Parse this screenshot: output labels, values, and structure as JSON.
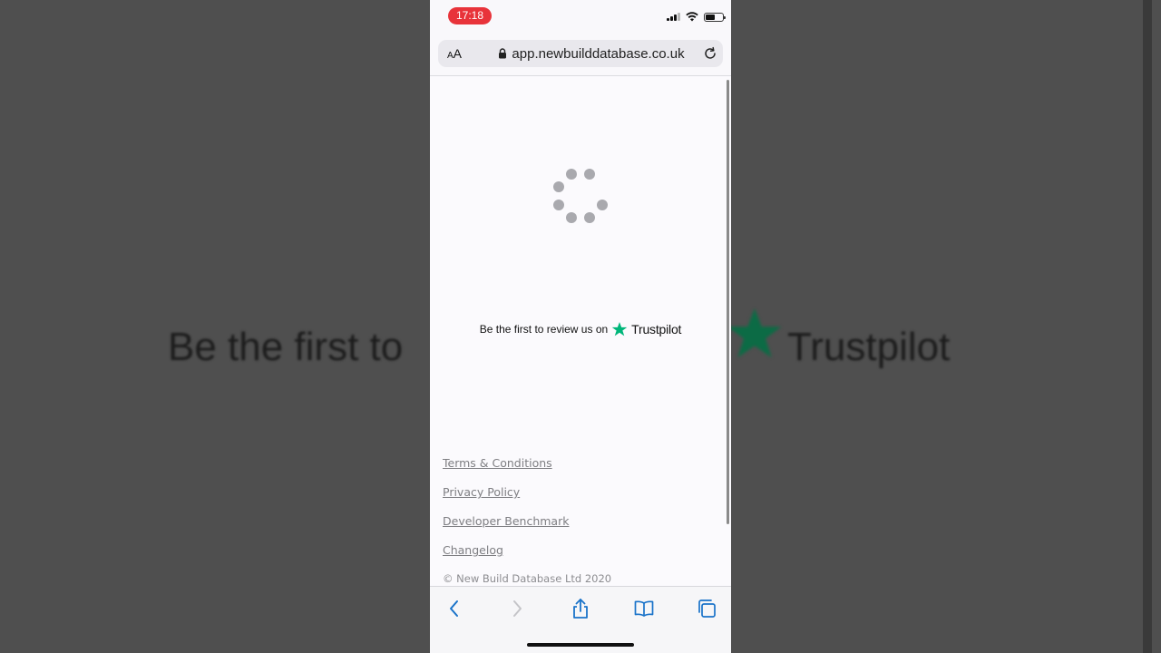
{
  "backdrop": {
    "left_text": "Be the first to",
    "right_text": "Trustpilot"
  },
  "status_bar": {
    "time": "17:18"
  },
  "browser": {
    "text_size_label": "AA",
    "url": "app.newbuilddatabase.co.uk"
  },
  "page": {
    "trustpilot_prompt": "Be the first to review us on",
    "trustpilot_brand": "Trustpilot",
    "footer_links": [
      "Terms & Conditions",
      "Privacy Policy",
      "Developer Benchmark",
      "Changelog"
    ],
    "copyright": "© New Build Database Ltd 2020"
  },
  "colors": {
    "time_pill": "#e8333a",
    "trustpilot_green": "#00b67a",
    "accent_blue": "#1a73c9"
  },
  "icons": [
    "lock-icon",
    "reload-icon",
    "back-icon",
    "forward-icon",
    "share-icon",
    "bookmarks-icon",
    "tabs-icon",
    "trustpilot-star-icon"
  ]
}
